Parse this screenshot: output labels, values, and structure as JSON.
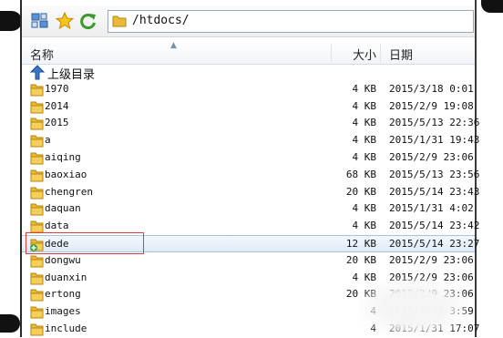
{
  "toolbar": {
    "buttons": [
      {
        "name": "view-options-icon"
      },
      {
        "name": "favorites-star-icon"
      },
      {
        "name": "refresh-icon"
      }
    ],
    "address_path": "/htdocs/"
  },
  "columns": {
    "name": "名称",
    "size": "大小",
    "date": "日期"
  },
  "up_row_label": "上级目录",
  "files": [
    {
      "name": "1970",
      "size": "4 KB",
      "date": "2015/3/18 0:01"
    },
    {
      "name": "2014",
      "size": "4 KB",
      "date": "2015/2/9 19:08"
    },
    {
      "name": "2015",
      "size": "4 KB",
      "date": "2015/5/13 22:36"
    },
    {
      "name": "a",
      "size": "4 KB",
      "date": "2015/1/31 19:43"
    },
    {
      "name": "aiqing",
      "size": "4 KB",
      "date": "2015/2/9 23:06"
    },
    {
      "name": "baoxiao",
      "size": "68 KB",
      "date": "2015/5/13 23:56"
    },
    {
      "name": "chengren",
      "size": "20 KB",
      "date": "2015/5/14 23:43"
    },
    {
      "name": "daquan",
      "size": "4 KB",
      "date": "2015/1/31 4:02"
    },
    {
      "name": "data",
      "size": "4 KB",
      "date": "2015/5/14 23:42"
    },
    {
      "name": "dede",
      "size": "12 KB",
      "date": "2015/5/14 23:27",
      "selected": true
    },
    {
      "name": "dongwu",
      "size": "20 KB",
      "date": "2015/2/9 23:06"
    },
    {
      "name": "duanxin",
      "size": "4 KB",
      "date": "2015/2/9 23:06"
    },
    {
      "name": "ertong",
      "size": "20 KB",
      "date": "2015/2/9 23:06"
    },
    {
      "name": "images",
      "size": "4",
      "date": "2015/1/31 3:59"
    },
    {
      "name": "include",
      "size": "4",
      "date": "2015/1/31 17:07"
    }
  ],
  "colors": {
    "folder": "#e8b93a",
    "selection": "#dfeaf7",
    "highlight_box": "#e03b3b"
  }
}
